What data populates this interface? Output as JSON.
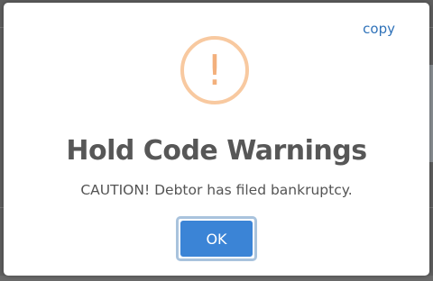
{
  "modal": {
    "copy_label": "copy",
    "icon": "exclamation-icon",
    "icon_glyph": "!",
    "title": "Hold Code Warnings",
    "message": "CAUTION! Debtor has filed bankruptcy.",
    "ok_label": "OK"
  },
  "colors": {
    "accent": "#3b84d6",
    "warning": "#f3b07c",
    "link": "#2f72b9"
  }
}
